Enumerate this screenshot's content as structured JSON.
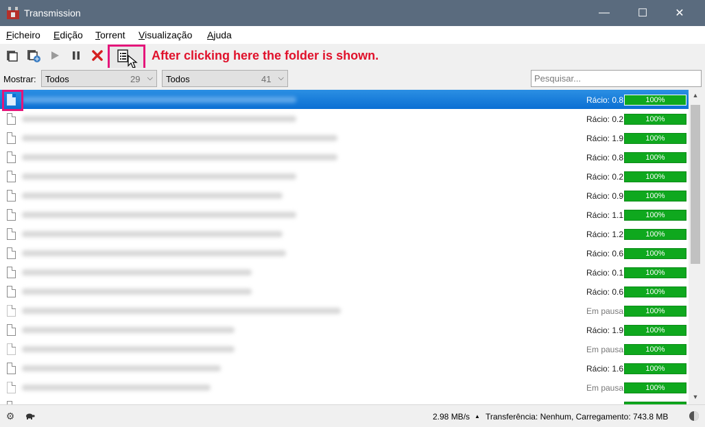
{
  "window": {
    "title": "Transmission",
    "controls": {
      "minimize": "—",
      "maximize": "☐",
      "close": "✕"
    }
  },
  "menu": [
    {
      "label": "Ficheiro",
      "accel": "F",
      "rest": "icheiro"
    },
    {
      "label": "Edição",
      "accel": "E",
      "rest": "dição"
    },
    {
      "label": "Torrent",
      "accel": "T",
      "rest": "orrent"
    },
    {
      "label": "Visualização",
      "accel": "V",
      "rest": "isualização"
    },
    {
      "label": "Ajuda",
      "accel": "A",
      "rest": "juda"
    }
  ],
  "toolbar": {
    "buttons": [
      "open-icon",
      "open-url-icon",
      "start-icon",
      "pause-icon",
      "remove-icon",
      "properties-icon"
    ],
    "annotation": "After clicking here the folder is shown.",
    "annotation_color": "#e0112b",
    "highlight_color": "#e5157a"
  },
  "filter": {
    "label": "Mostrar:",
    "activity": {
      "value": "Todos",
      "count": "29"
    },
    "tracker": {
      "value": "Todos",
      "count": "41"
    },
    "search_placeholder": "Pesquisar..."
  },
  "torrents": [
    {
      "status": "Rácio: 0.8",
      "progress": "100%",
      "selected": true
    },
    {
      "status": "Rácio: 0.2",
      "progress": "100%"
    },
    {
      "status": "Rácio: 1.9",
      "progress": "100%"
    },
    {
      "status": "Rácio: 0.8",
      "progress": "100%"
    },
    {
      "status": "Rácio: 0.2",
      "progress": "100%"
    },
    {
      "status": "Rácio: 0.9",
      "progress": "100%"
    },
    {
      "status": "Rácio: 1.1",
      "progress": "100%"
    },
    {
      "status": "Rácio: 1.2",
      "progress": "100%"
    },
    {
      "status": "Rácio: 0.6",
      "progress": "100%"
    },
    {
      "status": "Rácio: 0.1",
      "progress": "100%"
    },
    {
      "status": "Rácio: 0.6",
      "progress": "100%"
    },
    {
      "status": "Em pausa",
      "progress": "100%",
      "paused": true
    },
    {
      "status": "Rácio: 1.9",
      "progress": "100%"
    },
    {
      "status": "Em pausa",
      "progress": "100%",
      "paused": true
    },
    {
      "status": "Rácio: 1.6",
      "progress": "100%"
    },
    {
      "status": "Em pausa",
      "progress": "100%",
      "paused": true
    }
  ],
  "statusbar": {
    "speed": "2.98 MB/s",
    "transfer": "Transferência: Nenhum, Carregamento: 743.8 MB"
  },
  "colors": {
    "progress_green": "#0fa81e",
    "selection_blue": "#0b6fd3",
    "titlebar": "#5a6b7e"
  }
}
